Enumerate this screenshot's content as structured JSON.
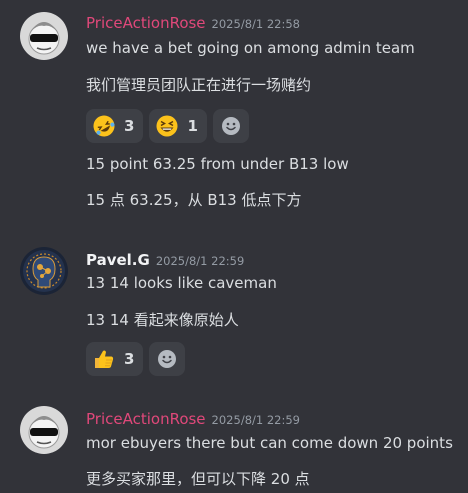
{
  "messages": [
    {
      "author": "PriceActionRose",
      "timestamp": "2025/8/1 22:58",
      "lines": [
        "we have  a bet going on among admin team",
        "我们管理员团队正在进行一场赌约"
      ],
      "reactions": [
        {
          "emoji": "rolling-on-floor-laughing",
          "count": "3"
        },
        {
          "emoji": "grinning-squinting-face",
          "count": "1"
        }
      ],
      "lines_after": [
        "15 point 63.25 from under B13 low",
        "15 点 63.25，从 B13 低点下方"
      ]
    },
    {
      "author": "Pavel.G",
      "timestamp": "2025/8/1 22:59",
      "lines": [
        "13 14 looks like caveman",
        "13 14 看起来像原始人"
      ],
      "reactions": [
        {
          "emoji": "thumbs-up",
          "count": "3"
        }
      ]
    },
    {
      "author": "PriceActionRose",
      "timestamp": "2025/8/1 22:59",
      "lines": [
        "mor ebuyers there but can come down 20 points",
        "更多买家那里，但可以下降 20 点"
      ]
    }
  ],
  "colors": {
    "background": "#323339",
    "reaction_background": "#3e4046",
    "username_pink": "#e0487a",
    "timestamp": "#949ba4",
    "text": "#dbdee1"
  }
}
